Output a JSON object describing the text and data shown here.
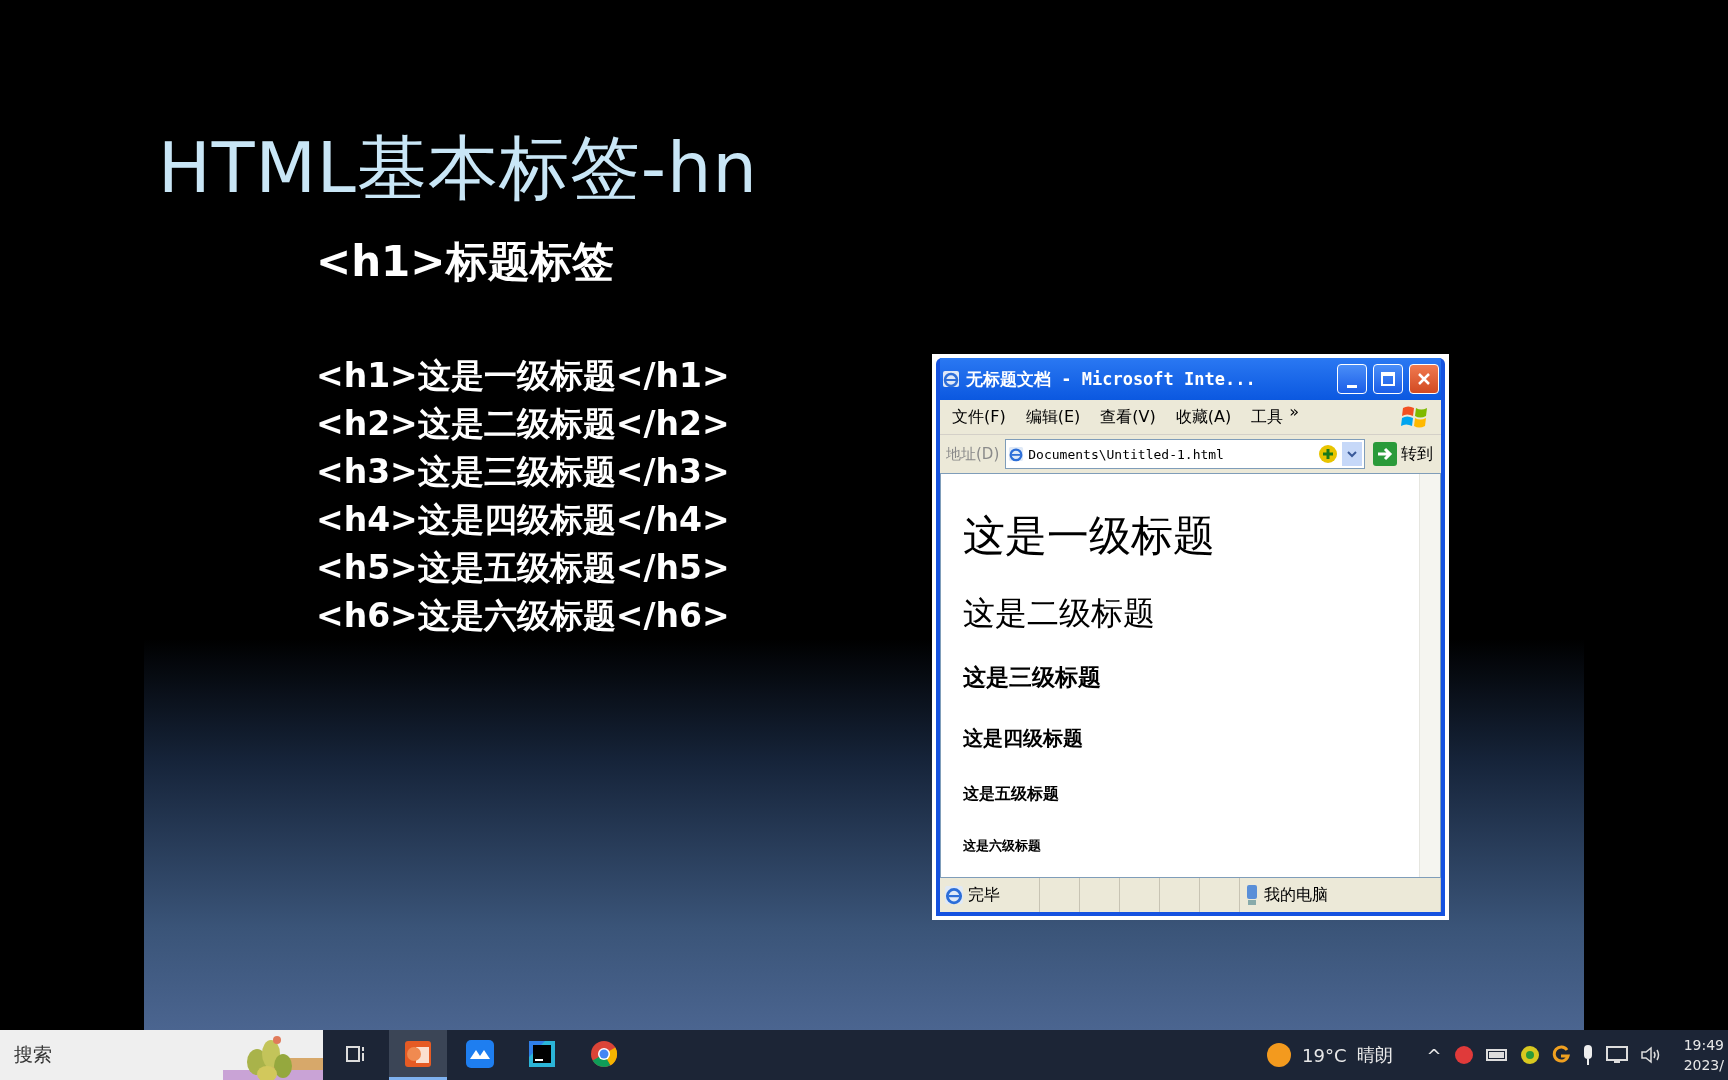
{
  "slide": {
    "title": "HTML基本标签-hn",
    "subtitle": "<h1>标题标签",
    "code_lines": [
      "<h1>这是一级标题</h1>",
      "<h2>这是二级标题</h2>",
      "<h3>这是三级标题</h3>",
      "<h4>这是四级标题</h4>",
      "<h5>这是五级标题</h5>",
      "<h6>这是六级标题</h6>"
    ]
  },
  "browser": {
    "title": "无标题文档 - Microsoft Inte...",
    "menu": [
      "文件(F)",
      "编辑(E)",
      "查看(V)",
      "收藏(A)",
      "工具"
    ],
    "menu_more": "»",
    "address_label": "地址(D)",
    "address": "Documents\\Untitled-1.html",
    "go": "转到",
    "headings": [
      {
        "kind": "h1",
        "text": "这是一级标题"
      },
      {
        "kind": "h2",
        "text": "这是二级标题"
      },
      {
        "kind": "h3",
        "text": "这是三级标题"
      },
      {
        "kind": "h4",
        "text": "这是四级标题"
      },
      {
        "kind": "h5",
        "text": "这是五级标题"
      },
      {
        "kind": "h6",
        "text": "这是六级标题"
      }
    ],
    "status": "完毕",
    "zone": "我的电脑"
  },
  "taskbar": {
    "search_placeholder": "搜索",
    "apps": [
      {
        "kind": "task-view",
        "selected": false
      },
      {
        "kind": "slides",
        "selected": true
      },
      {
        "kind": "cloud",
        "selected": false
      },
      {
        "kind": "ide",
        "selected": false
      },
      {
        "kind": "chrome",
        "selected": false
      }
    ],
    "weather": {
      "temp": "19°C",
      "condition": "晴朗"
    },
    "tray_caret": "^",
    "time": "19:49",
    "date": "2023/"
  }
}
